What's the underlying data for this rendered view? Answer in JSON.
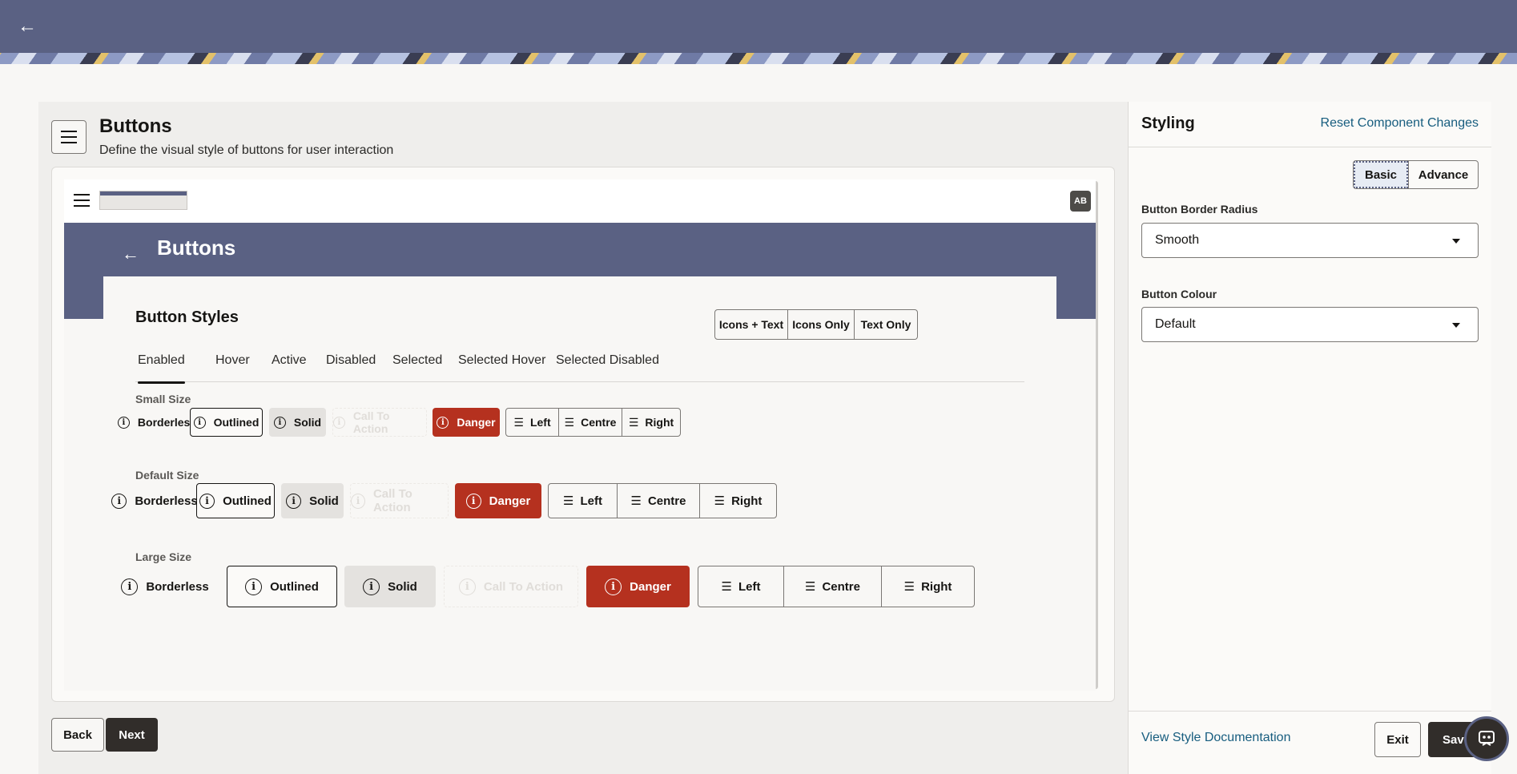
{
  "header": {
    "back_glyph": "←"
  },
  "page": {
    "title": "Buttons",
    "subtitle": "Define the visual style of buttons for user interaction",
    "back_label": "Back",
    "next_label": "Next"
  },
  "preview": {
    "avatar": "AB",
    "banner_title": "Buttons",
    "card_title": "Button Styles",
    "display_modes": [
      "Icons + Text",
      "Icons Only",
      "Text Only"
    ],
    "tabs": [
      "Enabled",
      "Hover",
      "Active",
      "Disabled",
      "Selected",
      "Selected Hover",
      "Selected Disabled"
    ],
    "active_tab": "Enabled",
    "sizes": [
      "Small Size",
      "Default Size",
      "Large Size"
    ],
    "buttons": {
      "borderless": "Borderless",
      "outlined": "Outlined",
      "solid": "Solid",
      "cta": "Call To Action",
      "danger": "Danger"
    },
    "align": [
      "Left",
      "Centre",
      "Right"
    ]
  },
  "panel": {
    "title": "Styling",
    "reset_link": "Reset Component Changes",
    "modes": [
      "Basic",
      "Advance"
    ],
    "selected_mode": "Basic",
    "border_radius_label": "Button Border Radius",
    "border_radius_value": "Smooth",
    "colour_label": "Button Colour",
    "colour_value": "Default",
    "doc_link": "View Style Documentation",
    "exit_label": "Exit",
    "save_label": "Save"
  },
  "colors": {
    "brand": "#5a6183",
    "danger": "#b5311f",
    "link": "#175d7f",
    "dark": "#312d2a"
  }
}
